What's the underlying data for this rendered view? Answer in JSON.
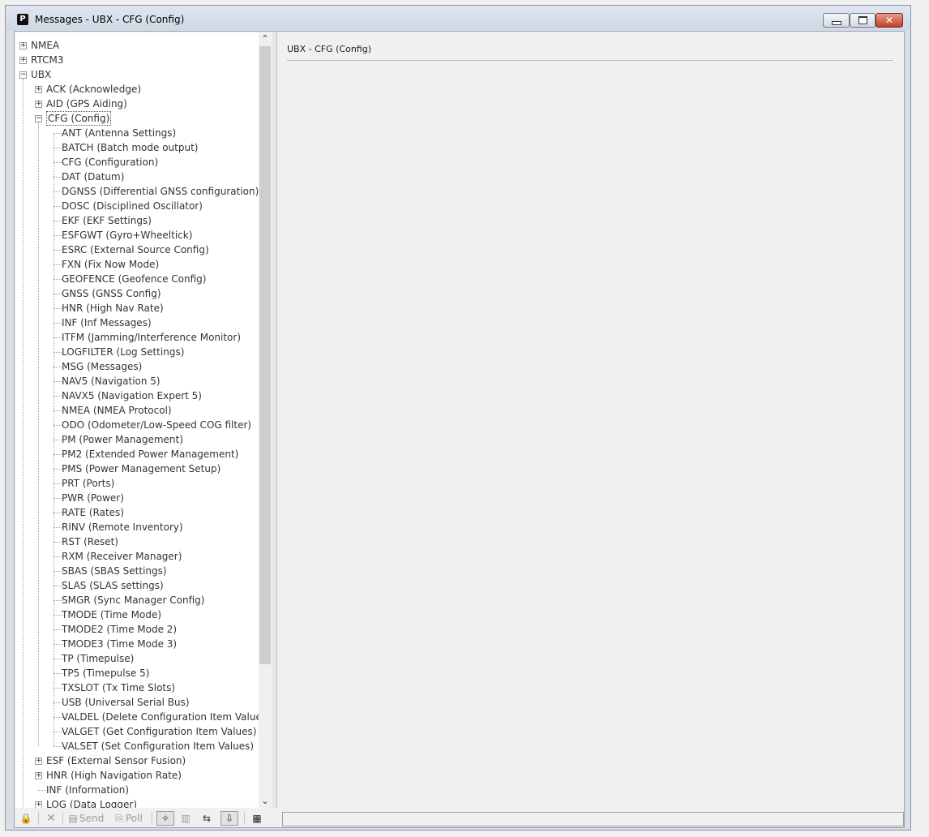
{
  "window": {
    "title": "Messages - UBX - CFG (Config)",
    "app_icon_letter": "P"
  },
  "tree": {
    "top_nodes": [
      {
        "label": "NMEA",
        "expander": "+"
      },
      {
        "label": "RTCM3",
        "expander": "+"
      },
      {
        "label": "UBX",
        "expander": "−"
      }
    ],
    "ubx_children_before": [
      {
        "label": "ACK (Acknowledge)",
        "expander": "+"
      },
      {
        "label": "AID (GPS Aiding)",
        "expander": "+"
      },
      {
        "label": "CFG (Config)",
        "expander": "−"
      }
    ],
    "cfg_items": [
      "ANT (Antenna Settings)",
      "BATCH (Batch mode output)",
      "CFG (Configuration)",
      "DAT (Datum)",
      "DGNSS (Differential GNSS configuration)",
      "DOSC (Disciplined Oscillator)",
      "EKF (EKF Settings)",
      "ESFGWT (Gyro+Wheeltick)",
      "ESRC (External Source Config)",
      "FXN (Fix Now Mode)",
      "GEOFENCE (Geofence Config)",
      "GNSS (GNSS Config)",
      "HNR (High Nav Rate)",
      "INF (Inf Messages)",
      "ITFM (Jamming/Interference Monitor)",
      "LOGFILTER (Log Settings)",
      "MSG (Messages)",
      "NAV5 (Navigation 5)",
      "NAVX5 (Navigation Expert 5)",
      "NMEA (NMEA Protocol)",
      "ODO (Odometer/Low-Speed COG filter)",
      "PM (Power Management)",
      "PM2 (Extended Power Management)",
      "PMS (Power Management Setup)",
      "PRT (Ports)",
      "PWR (Power)",
      "RATE (Rates)",
      "RINV (Remote Inventory)",
      "RST (Reset)",
      "RXM (Receiver Manager)",
      "SBAS (SBAS Settings)",
      "SLAS (SLAS settings)",
      "SMGR (Sync Manager Config)",
      "TMODE (Time Mode)",
      "TMODE2 (Time Mode 2)",
      "TMODE3 (Time Mode 3)",
      "TP (Timepulse)",
      "TP5 (Timepulse 5)",
      "TXSLOT (Tx Time Slots)",
      "USB (Universal Serial Bus)",
      "VALDEL (Delete Configuration Item Values)",
      "VALGET (Get Configuration Item Values)",
      "VALSET (Set Configuration Item Values)"
    ],
    "ubx_children_after": [
      {
        "label": "ESF (External Sensor Fusion)",
        "expander": "+"
      },
      {
        "label": "HNR (High Navigation Rate)",
        "expander": "+"
      },
      {
        "label": "INF (Information)",
        "expander": ""
      },
      {
        "label": "LOG (Data Logger)",
        "expander": "+"
      }
    ]
  },
  "detail": {
    "title": "UBX - CFG (Config)"
  },
  "toolbar": {
    "lock_icon": "lock-icon",
    "send_label": "Send",
    "poll_label": "Poll"
  }
}
